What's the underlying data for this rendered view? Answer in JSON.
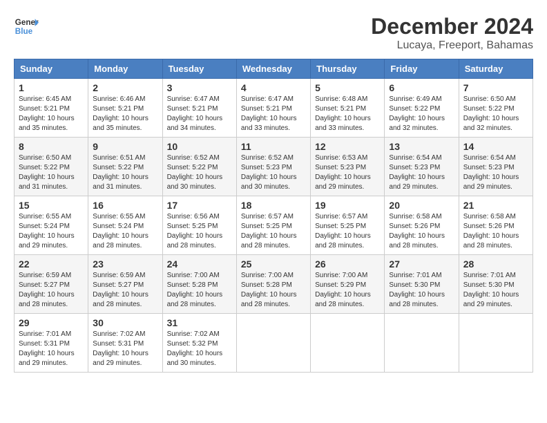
{
  "header": {
    "logo_line1": "General",
    "logo_line2": "Blue",
    "main_title": "December 2024",
    "subtitle": "Lucaya, Freeport, Bahamas"
  },
  "weekdays": [
    "Sunday",
    "Monday",
    "Tuesday",
    "Wednesday",
    "Thursday",
    "Friday",
    "Saturday"
  ],
  "weeks": [
    [
      {
        "day": "1",
        "sunrise": "6:45 AM",
        "sunset": "5:21 PM",
        "daylight": "10 hours and 35 minutes."
      },
      {
        "day": "2",
        "sunrise": "6:46 AM",
        "sunset": "5:21 PM",
        "daylight": "10 hours and 35 minutes."
      },
      {
        "day": "3",
        "sunrise": "6:47 AM",
        "sunset": "5:21 PM",
        "daylight": "10 hours and 34 minutes."
      },
      {
        "day": "4",
        "sunrise": "6:47 AM",
        "sunset": "5:21 PM",
        "daylight": "10 hours and 33 minutes."
      },
      {
        "day": "5",
        "sunrise": "6:48 AM",
        "sunset": "5:21 PM",
        "daylight": "10 hours and 33 minutes."
      },
      {
        "day": "6",
        "sunrise": "6:49 AM",
        "sunset": "5:22 PM",
        "daylight": "10 hours and 32 minutes."
      },
      {
        "day": "7",
        "sunrise": "6:50 AM",
        "sunset": "5:22 PM",
        "daylight": "10 hours and 32 minutes."
      }
    ],
    [
      {
        "day": "8",
        "sunrise": "6:50 AM",
        "sunset": "5:22 PM",
        "daylight": "10 hours and 31 minutes."
      },
      {
        "day": "9",
        "sunrise": "6:51 AM",
        "sunset": "5:22 PM",
        "daylight": "10 hours and 31 minutes."
      },
      {
        "day": "10",
        "sunrise": "6:52 AM",
        "sunset": "5:22 PM",
        "daylight": "10 hours and 30 minutes."
      },
      {
        "day": "11",
        "sunrise": "6:52 AM",
        "sunset": "5:23 PM",
        "daylight": "10 hours and 30 minutes."
      },
      {
        "day": "12",
        "sunrise": "6:53 AM",
        "sunset": "5:23 PM",
        "daylight": "10 hours and 29 minutes."
      },
      {
        "day": "13",
        "sunrise": "6:54 AM",
        "sunset": "5:23 PM",
        "daylight": "10 hours and 29 minutes."
      },
      {
        "day": "14",
        "sunrise": "6:54 AM",
        "sunset": "5:23 PM",
        "daylight": "10 hours and 29 minutes."
      }
    ],
    [
      {
        "day": "15",
        "sunrise": "6:55 AM",
        "sunset": "5:24 PM",
        "daylight": "10 hours and 29 minutes."
      },
      {
        "day": "16",
        "sunrise": "6:55 AM",
        "sunset": "5:24 PM",
        "daylight": "10 hours and 28 minutes."
      },
      {
        "day": "17",
        "sunrise": "6:56 AM",
        "sunset": "5:25 PM",
        "daylight": "10 hours and 28 minutes."
      },
      {
        "day": "18",
        "sunrise": "6:57 AM",
        "sunset": "5:25 PM",
        "daylight": "10 hours and 28 minutes."
      },
      {
        "day": "19",
        "sunrise": "6:57 AM",
        "sunset": "5:25 PM",
        "daylight": "10 hours and 28 minutes."
      },
      {
        "day": "20",
        "sunrise": "6:58 AM",
        "sunset": "5:26 PM",
        "daylight": "10 hours and 28 minutes."
      },
      {
        "day": "21",
        "sunrise": "6:58 AM",
        "sunset": "5:26 PM",
        "daylight": "10 hours and 28 minutes."
      }
    ],
    [
      {
        "day": "22",
        "sunrise": "6:59 AM",
        "sunset": "5:27 PM",
        "daylight": "10 hours and 28 minutes."
      },
      {
        "day": "23",
        "sunrise": "6:59 AM",
        "sunset": "5:27 PM",
        "daylight": "10 hours and 28 minutes."
      },
      {
        "day": "24",
        "sunrise": "7:00 AM",
        "sunset": "5:28 PM",
        "daylight": "10 hours and 28 minutes."
      },
      {
        "day": "25",
        "sunrise": "7:00 AM",
        "sunset": "5:28 PM",
        "daylight": "10 hours and 28 minutes."
      },
      {
        "day": "26",
        "sunrise": "7:00 AM",
        "sunset": "5:29 PM",
        "daylight": "10 hours and 28 minutes."
      },
      {
        "day": "27",
        "sunrise": "7:01 AM",
        "sunset": "5:30 PM",
        "daylight": "10 hours and 28 minutes."
      },
      {
        "day": "28",
        "sunrise": "7:01 AM",
        "sunset": "5:30 PM",
        "daylight": "10 hours and 29 minutes."
      }
    ],
    [
      {
        "day": "29",
        "sunrise": "7:01 AM",
        "sunset": "5:31 PM",
        "daylight": "10 hours and 29 minutes."
      },
      {
        "day": "30",
        "sunrise": "7:02 AM",
        "sunset": "5:31 PM",
        "daylight": "10 hours and 29 minutes."
      },
      {
        "day": "31",
        "sunrise": "7:02 AM",
        "sunset": "5:32 PM",
        "daylight": "10 hours and 30 minutes."
      },
      null,
      null,
      null,
      null
    ]
  ]
}
